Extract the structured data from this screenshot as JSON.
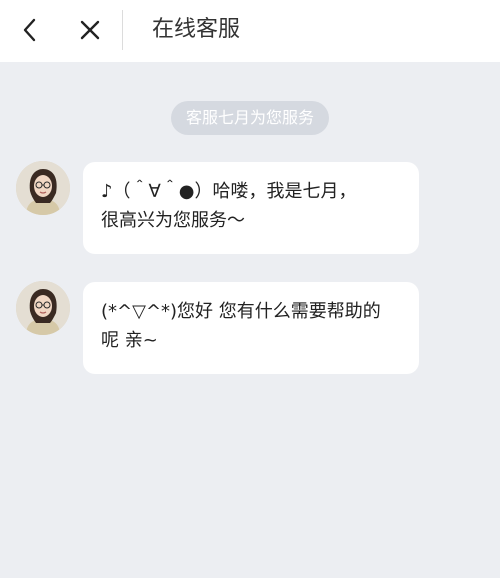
{
  "header": {
    "title": "在线客服"
  },
  "chat": {
    "notice": "客服七月为您服务",
    "messages": [
      {
        "text": "♪（＾∀＾●）哈喽，我是七月，\n很高兴为您服务～"
      },
      {
        "text": "(*^▽^*)您好  您有什么需要帮助的\n呢  亲~"
      }
    ]
  },
  "colors": {
    "header_bg": "#ffffff",
    "page_bg": "#eceef2",
    "bubble_bg": "#ffffff",
    "notice_bg": "#d5d9e0"
  },
  "icons": {
    "back": "chevron-left-icon",
    "close": "close-icon"
  }
}
